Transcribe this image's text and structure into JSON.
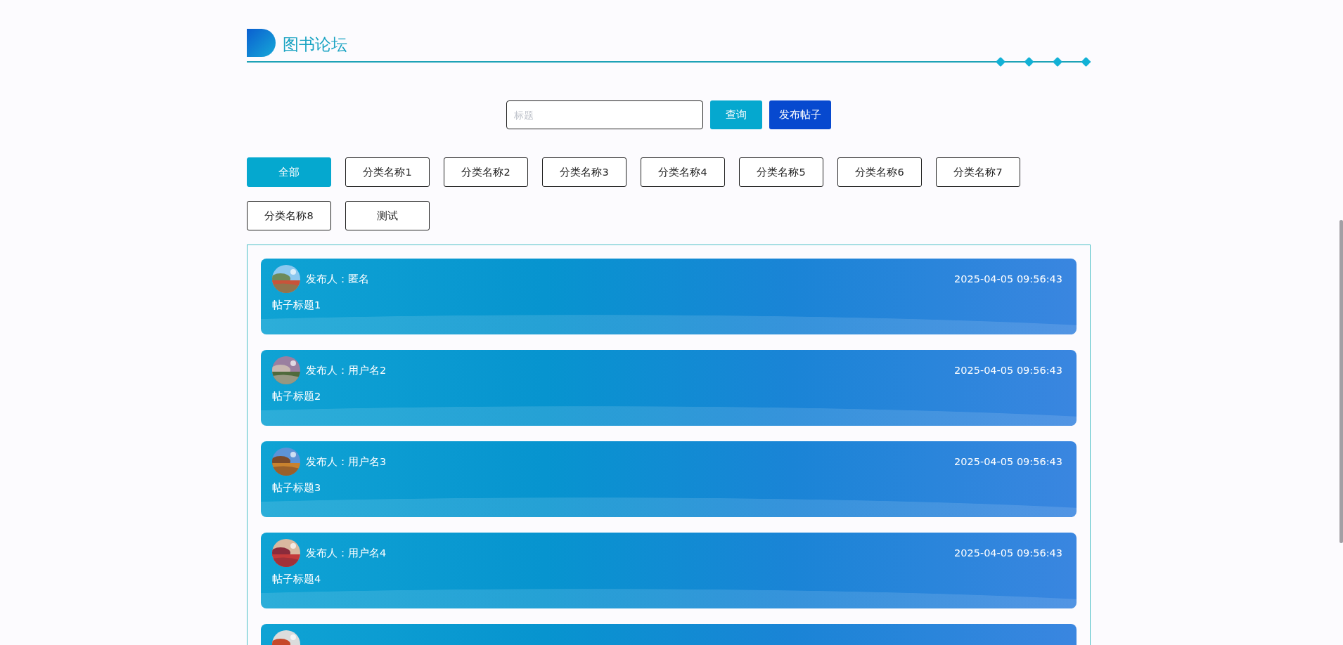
{
  "header": {
    "title": "图书论坛"
  },
  "search": {
    "placeholder": "标题",
    "buttons": [
      {
        "label": "查询",
        "kind": "query"
      },
      {
        "label": "发布帖子",
        "kind": "publish"
      }
    ]
  },
  "categories": [
    {
      "label": "全部",
      "selected": true
    },
    {
      "label": "分类名称1",
      "selected": false
    },
    {
      "label": "分类名称2",
      "selected": false
    },
    {
      "label": "分类名称3",
      "selected": false
    },
    {
      "label": "分类名称4",
      "selected": false
    },
    {
      "label": "分类名称5",
      "selected": false
    },
    {
      "label": "分类名称6",
      "selected": false
    },
    {
      "label": "分类名称7",
      "selected": false
    },
    {
      "label": "分类名称8",
      "selected": false
    },
    {
      "label": "测试",
      "selected": false
    }
  ],
  "posts": [
    {
      "kind": "post",
      "poster": "发布人：匿名",
      "time": "2025-04-05 09:56:43",
      "title": "帖子标题1"
    },
    {
      "kind": "post",
      "poster": "发布人：用户名2",
      "time": "2025-04-05 09:56:43",
      "title": "帖子标题2"
    },
    {
      "kind": "post",
      "poster": "发布人：用户名3",
      "time": "2025-04-05 09:56:43",
      "title": "帖子标题3"
    },
    {
      "kind": "post",
      "poster": "发布人：用户名4",
      "time": "2025-04-05 09:56:43",
      "title": "帖子标题4"
    },
    {
      "kind": "cut"
    }
  ]
}
